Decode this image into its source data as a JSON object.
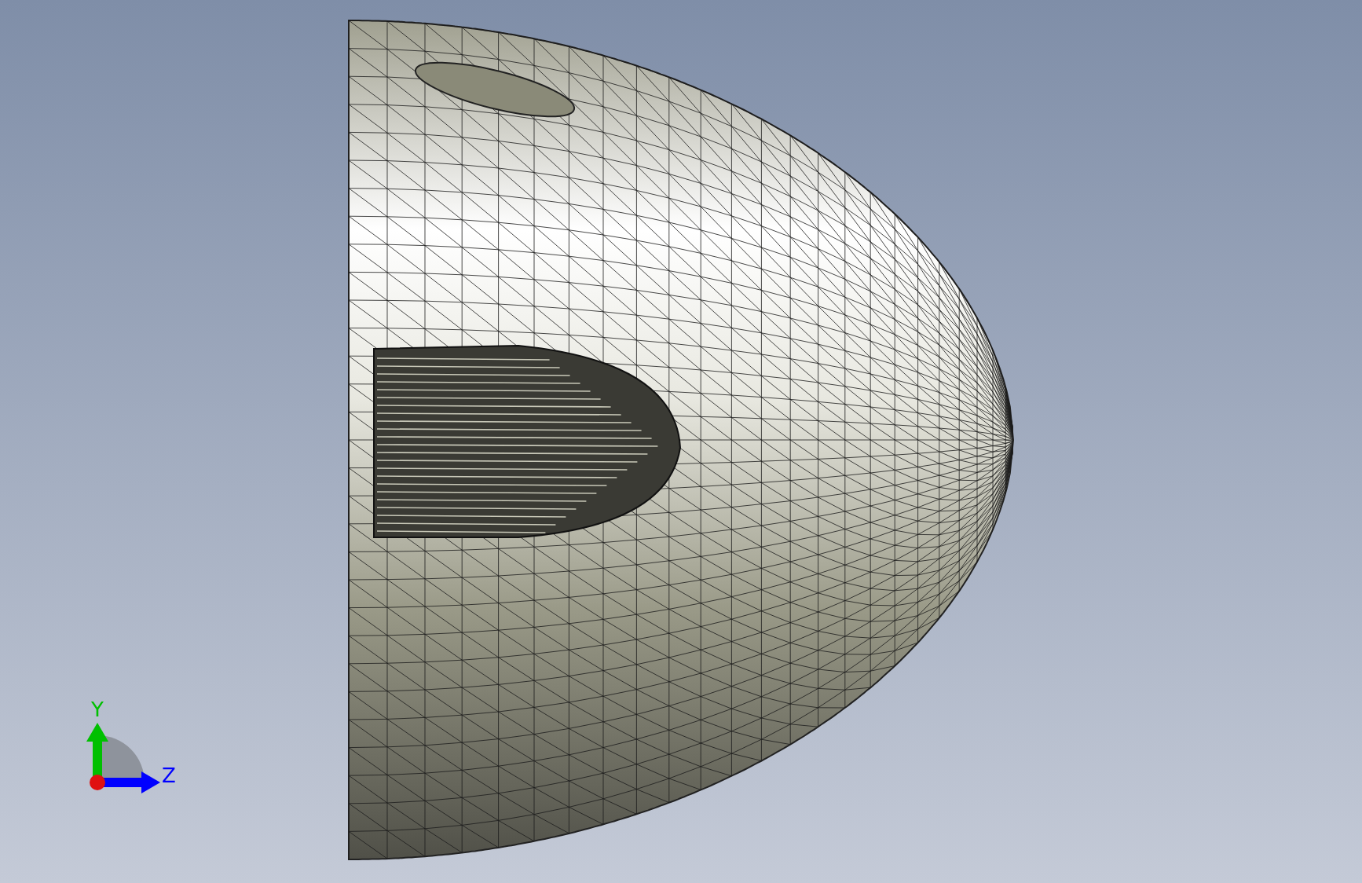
{
  "viewport": {
    "triad": {
      "axes": [
        {
          "kind": "vertical",
          "label": "Y",
          "color": "#00c000"
        },
        {
          "kind": "horizontal",
          "label": "Z",
          "color": "#0000ff"
        }
      ]
    }
  }
}
